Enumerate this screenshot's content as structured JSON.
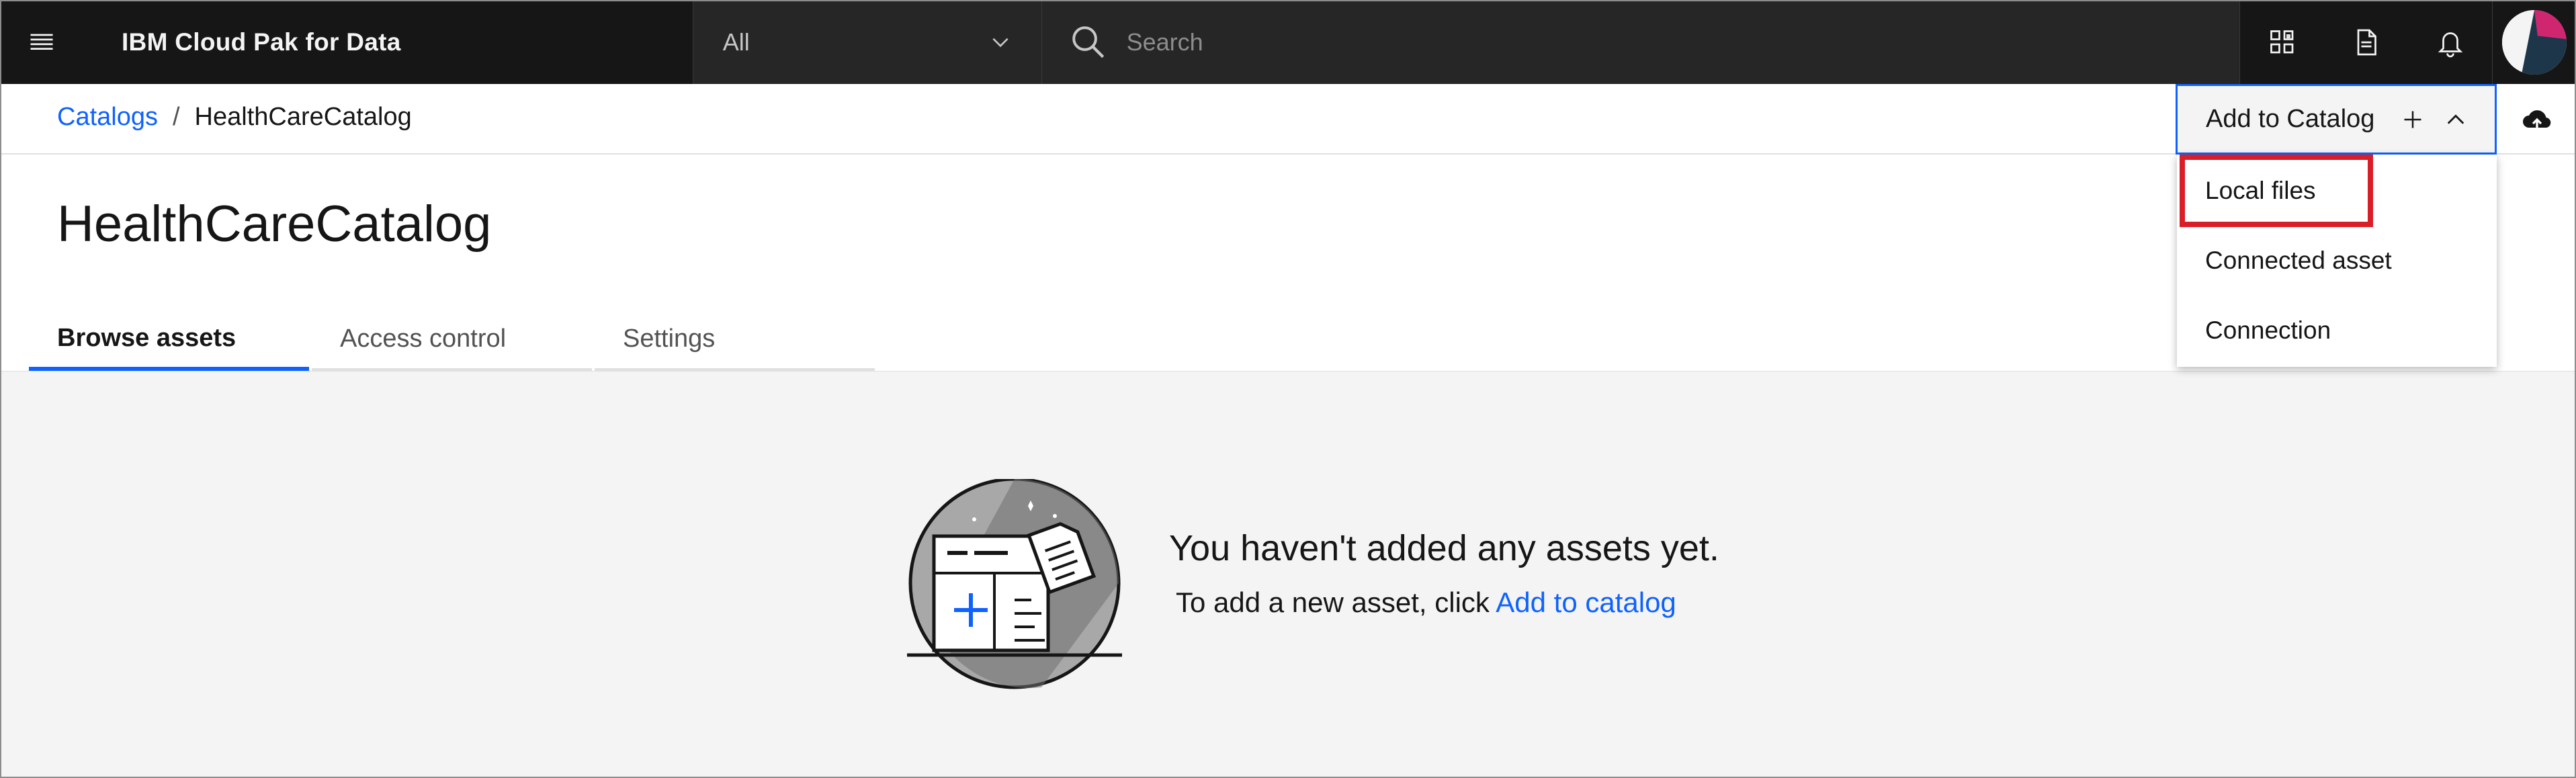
{
  "header": {
    "app_title": "IBM Cloud Pak for Data",
    "scope_selected": "All",
    "search_placeholder": "Search",
    "icons": [
      "hamburger-menu-icon",
      "chevron-down-icon",
      "search-icon",
      "catalog-grid-icon",
      "document-icon",
      "notification-bell-icon",
      "user-avatar"
    ]
  },
  "breadcrumb": {
    "parent": "Catalogs",
    "separator": "/",
    "current": "HealthCareCatalog"
  },
  "add_button": {
    "label": "Add to Catalog",
    "plus_icon": "plus-icon",
    "chevron_icon": "chevron-up-icon"
  },
  "cloud_icon": "cloud-upload-icon",
  "dropdown": {
    "items": [
      {
        "label": "Local files"
      },
      {
        "label": "Connected asset"
      },
      {
        "label": "Connection"
      }
    ],
    "highlight_color": "#da1e28"
  },
  "page": {
    "title": "HealthCareCatalog"
  },
  "tabs": [
    {
      "label": "Browse assets",
      "active": true
    },
    {
      "label": "Access control",
      "active": false
    },
    {
      "label": "Settings",
      "active": false
    }
  ],
  "empty_state": {
    "title": "You haven't added any assets yet.",
    "subtitle_prefix": "To add a new asset, click",
    "subtitle_link": "Add to catalog",
    "illustration": "empty-assets-illustration"
  },
  "colors": {
    "header_bg": "#161616",
    "accent": "#0f62fe",
    "content_bg": "#f4f4f4"
  }
}
